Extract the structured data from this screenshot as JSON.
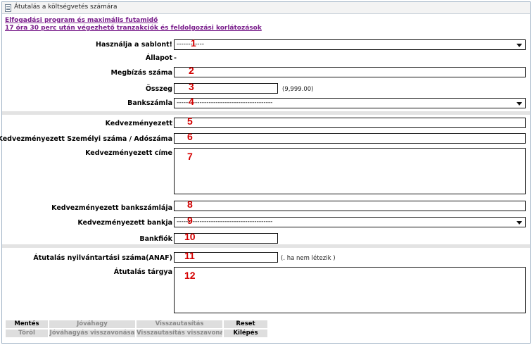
{
  "window": {
    "title": "Átutalás a költségvetés számára"
  },
  "links": {
    "program": "Elfogadási program és maximális futamidő",
    "limits": "17 óra 30 perc után végezhető tranzakciók és feldolgozási korlátozások"
  },
  "form": {
    "template": {
      "label": "Használja a sablont!",
      "value": "------------",
      "number": "1"
    },
    "status": {
      "label": "Állapot",
      "value": "-"
    },
    "order_number": {
      "label": "Megbízás száma",
      "value": "",
      "number": "2"
    },
    "amount": {
      "label": "Összeg",
      "value": "",
      "hint": "(9,999.00)",
      "number": "3"
    },
    "bank_account": {
      "label": "Bankszámla",
      "value": "------------------------------------------",
      "number": "4"
    },
    "beneficiary": {
      "label": "Kedvezményezett",
      "value": "",
      "number": "5"
    },
    "beneficiary_id": {
      "label": "Kedvezményezett Személyi száma / Adószáma",
      "value": "",
      "number": "6"
    },
    "beneficiary_address": {
      "label": "Kedvezményezett címe",
      "value": "",
      "number": "7"
    },
    "beneficiary_account": {
      "label": "Kedvezményezett bankszámlája",
      "value": "",
      "number": "8"
    },
    "beneficiary_bank": {
      "label": "Kedvezményezett bankja",
      "value": "------------------------------------------",
      "number": "9"
    },
    "branch": {
      "label": "Bankfiók",
      "value": "",
      "number": "10"
    },
    "transfer_reg_number": {
      "label": "Átutalás nyilvántartási száma(ANAF)",
      "value": "",
      "hint": "(. ha nem létezik )",
      "number": "11"
    },
    "transfer_subject": {
      "label": "Átutalás tárgya",
      "value": "",
      "number": "12"
    }
  },
  "buttons": {
    "save": "Mentés",
    "approve": "Jóváhagy",
    "reject": "Visszautasítás",
    "reset": "Reset",
    "delete": "Töröl",
    "approve_revoke": "Jóváhagyás visszavonása",
    "reject_revoke": "Visszautasítás visszavonás",
    "exit": "Kilépés"
  }
}
